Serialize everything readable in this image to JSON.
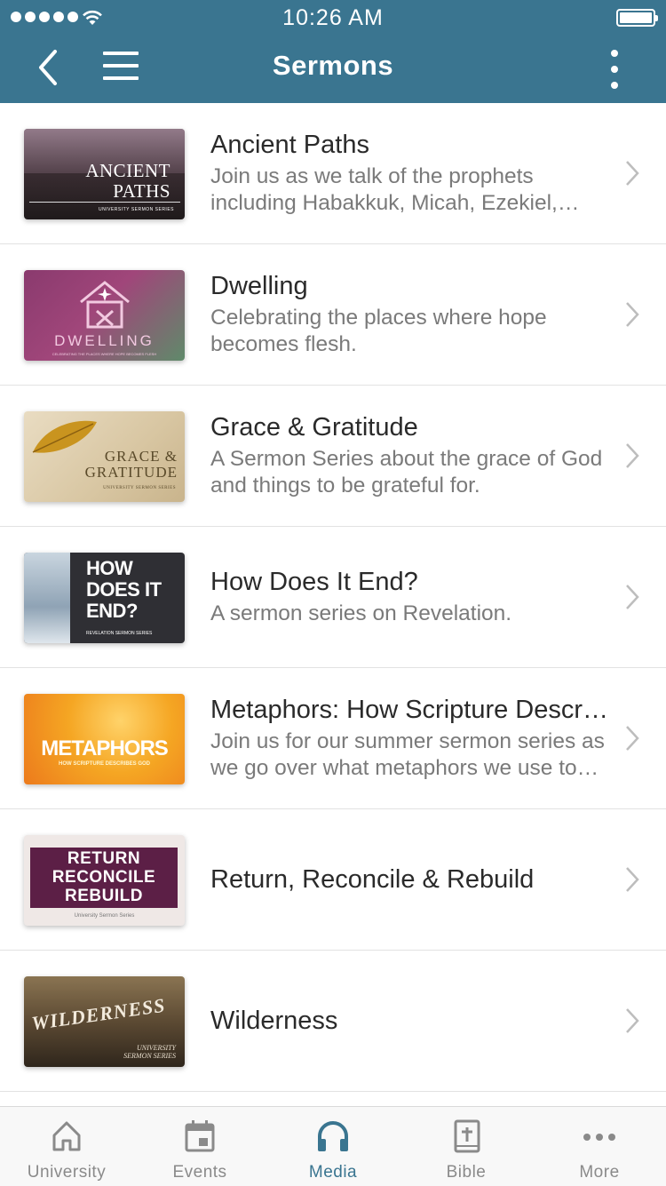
{
  "status_bar": {
    "time": "10:26 AM"
  },
  "header": {
    "title": "Sermons"
  },
  "sermons": [
    {
      "title": "Ancient Paths",
      "description": "Join us as we talk of the prophets including Habakkuk, Micah, Ezekiel, Jeremiah and more.",
      "thumb_text": "ANCIENT PATHS",
      "thumb_sub": "UNIVERSITY SERMON SERIES"
    },
    {
      "title": "Dwelling",
      "description": "Celebrating the places where hope becomes flesh.",
      "thumb_text": "DWELLING",
      "thumb_sub": "CELEBRATING THE PLACES WHERE HOPE BECOMES FLESH"
    },
    {
      "title": "Grace & Gratitude",
      "description": "A Sermon Series about the grace of God and things to be grateful for.",
      "thumb_text": "GRACE & GRATITUDE",
      "thumb_sub": "UNIVERSITY SERMON SERIES"
    },
    {
      "title": "How Does It End?",
      "description": "A sermon series on Revelation.",
      "thumb_text": "HOW DOES IT END?",
      "thumb_sub": "REVELATION SERMON SERIES"
    },
    {
      "title": "Metaphors: How Scripture Describes God",
      "description": "Join us for our summer sermon series as we go over what metaphors we use to describe God.",
      "thumb_text": "METAPHORS",
      "thumb_sub": "HOW SCRIPTURE DESCRIBES GOD"
    },
    {
      "title": "Return, Reconcile & Rebuild",
      "description": "",
      "thumb_text": "RETURN RECONCILE REBUILD",
      "thumb_sub": "University Sermon Series"
    },
    {
      "title": "Wilderness",
      "description": "",
      "thumb_text": "WILDERNESS",
      "thumb_sub": "UNIVERSITY SERMON SERIES"
    }
  ],
  "tabs": [
    {
      "label": "University",
      "icon": "home-icon"
    },
    {
      "label": "Events",
      "icon": "calendar-icon"
    },
    {
      "label": "Media",
      "icon": "headphones-icon",
      "active": true
    },
    {
      "label": "Bible",
      "icon": "bible-icon"
    },
    {
      "label": "More",
      "icon": "more-icon"
    }
  ],
  "colors": {
    "brand": "#3a7590",
    "inactive_tab": "#8a8a8a"
  }
}
